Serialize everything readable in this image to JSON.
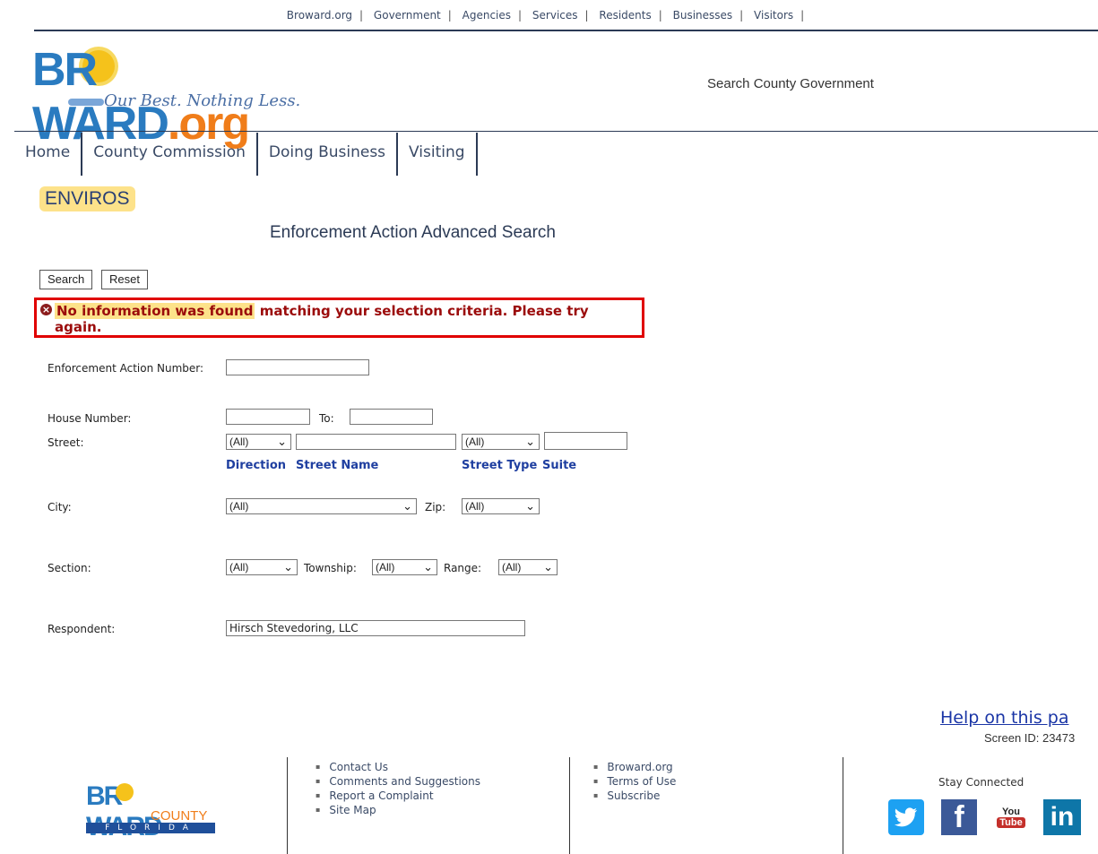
{
  "top_links": [
    "Broward.org",
    "Government",
    "Agencies",
    "Services",
    "Residents",
    "Businesses",
    "Visitors"
  ],
  "logo": {
    "main": "BR",
    "main2": "WARD",
    "org": ".org",
    "tagline": "Our Best. Nothing Less."
  },
  "search_government": "Search County Government",
  "nav": [
    "Home",
    "County Commission",
    "Doing Business",
    "Visiting"
  ],
  "section_badge": "ENVIROS",
  "page_title": "Enforcement Action Advanced Search",
  "buttons": {
    "search": "Search",
    "reset": "Reset"
  },
  "error": {
    "icon": "error-circle-icon",
    "highlight": "No information was found",
    "rest": " matching your selection criteria. Please try again."
  },
  "form": {
    "ea_number_label": "Enforcement Action Number:",
    "ea_number_value": "",
    "house_number_label": "House Number:",
    "house_from_value": "",
    "to_label": "To:",
    "house_to_value": "",
    "street_label": "Street:",
    "direction_value": "(All)",
    "street_name_value": "",
    "street_type_value": "(All)",
    "suite_value": "",
    "direction_caption": "Direction",
    "street_name_caption": "Street Name",
    "street_type_caption": "Street Type",
    "suite_caption": "Suite",
    "city_label": "City:",
    "city_value": "(All)",
    "zip_label": "Zip:",
    "zip_value": "(All)",
    "section_label": "Section:",
    "section_value": "(All)",
    "township_label": "Township:",
    "township_value": "(All)",
    "range_label": "Range:",
    "range_value": "(All)",
    "respondent_label": "Respondent:",
    "respondent_value": "Hirsch Stevedoring, LLC"
  },
  "help": "Help on this pa",
  "screen_id": "Screen ID: 23473",
  "footer": {
    "logo": {
      "main": "BR",
      "main2": "WARD",
      "county": "COUNTY",
      "state": "FLORIDA"
    },
    "col1": [
      "Contact Us",
      "Comments and Suggestions",
      "Report a Complaint",
      "Site Map"
    ],
    "col2": [
      "Broward.org",
      "Terms of Use",
      "Subscribe"
    ],
    "stay_connected": "Stay Connected",
    "social": {
      "youtube_top": "You",
      "youtube_bottom": "Tube",
      "linkedin": "in",
      "facebook": "f"
    }
  },
  "colors": {
    "accent": "#2b3a55",
    "error": "#e00000",
    "highlight": "#fde28a",
    "twitter": "#1da1f2",
    "facebook": "#3b5998",
    "youtube": "#c4302b",
    "linkedin": "#0e76a8"
  }
}
